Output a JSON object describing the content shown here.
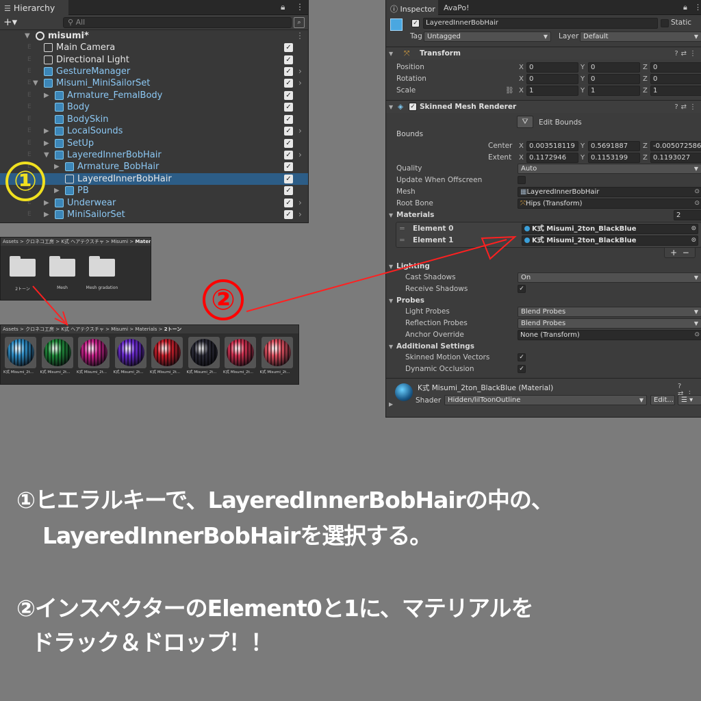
{
  "hierarchy": {
    "tab_label": "Hierarchy",
    "search_placeholder": "All",
    "rows": [
      {
        "label": "misumi*",
        "color": "white"
      },
      {
        "label": "Main Camera",
        "color": "white"
      },
      {
        "label": "Directional Light",
        "color": "white"
      },
      {
        "label": "GestureManager",
        "color": "blue"
      },
      {
        "label": "Misumi_MiniSailorSet",
        "color": "blue"
      },
      {
        "label": "Armature_FemalBody",
        "color": "blue"
      },
      {
        "label": "Body",
        "color": "blue"
      },
      {
        "label": "BodySkin",
        "color": "blue"
      },
      {
        "label": "LocalSounds",
        "color": "blue"
      },
      {
        "label": "SetUp",
        "color": "blue"
      },
      {
        "label": "LayeredInnerBobHair",
        "color": "blue"
      },
      {
        "label": "Armature_BobHair",
        "color": "blue"
      },
      {
        "label": "LayeredInnerBobHair",
        "color": "white"
      },
      {
        "label": "PB",
        "color": "blue"
      },
      {
        "label": "Underwear",
        "color": "blue"
      },
      {
        "label": "MiniSailorSet",
        "color": "blue"
      }
    ]
  },
  "project_folders": {
    "breadcrumb": [
      "Assets",
      "クロネコ工房",
      "K式 ヘアテクスチャ",
      "Misumi"
    ],
    "breadcrumb_last": "Materials",
    "folders": [
      "2トーン",
      "Mesh",
      "Mesh gradation"
    ]
  },
  "project_materials": {
    "breadcrumb": [
      "Assets",
      "クロネコ工房",
      "K式 ヘアテクスチャ",
      "Misumi",
      "Materials"
    ],
    "breadcrumb_last": "2トーン",
    "items": [
      {
        "label": "K式 Misumi_2t...",
        "color": "#2f8fc8"
      },
      {
        "label": "K式 Misumi_2t...",
        "color": "#1f8a3a"
      },
      {
        "label": "K式 Misumi_2t...",
        "color": "#c8208a"
      },
      {
        "label": "K式 Misumi_2t...",
        "color": "#6a2ad0"
      },
      {
        "label": "K式 Misumi_2t...",
        "color": "#c81e2a"
      },
      {
        "label": "K式 Misumi_2t...",
        "color": "#2a2a36"
      },
      {
        "label": "K式 Misumi_2t...",
        "color": "#d03050"
      },
      {
        "label": "K式 Misumi_2t...",
        "color": "#e05060"
      }
    ]
  },
  "inspector": {
    "tab1": "Inspector",
    "tab2": "AvaPo!",
    "object_name": "LayeredInnerBobHair",
    "static_label": "Static",
    "tag_label": "Tag",
    "tag_value": "Untagged",
    "layer_label": "Layer",
    "layer_value": "Default",
    "transform": {
      "title": "Transform",
      "position_label": "Position",
      "rotation_label": "Rotation",
      "scale_label": "Scale",
      "position": [
        "0",
        "0",
        "0"
      ],
      "rotation": [
        "0",
        "0",
        "0"
      ],
      "scale": [
        "1",
        "1",
        "1"
      ]
    },
    "smr": {
      "title": "Skinned Mesh Renderer",
      "edit_bounds": "Edit Bounds",
      "bounds_label": "Bounds",
      "center_label": "Center",
      "extent_label": "Extent",
      "center": [
        "0.003518119",
        "0.5691887",
        "-0.005072586"
      ],
      "extent": [
        "0.1172946",
        "0.1153199",
        "0.1193027"
      ],
      "quality_label": "Quality",
      "quality_value": "Auto",
      "update_offscreen_label": "Update When Offscreen",
      "mesh_label": "Mesh",
      "mesh_value": "LayeredInnerBobHair",
      "root_bone_label": "Root Bone",
      "root_bone_value": "Hips (Transform)",
      "materials_label": "Materials",
      "materials_count": "2",
      "elements": [
        {
          "label": "Element 0",
          "value": "K式 Misumi_2ton_BlackBlue"
        },
        {
          "label": "Element 1",
          "value": "K式 Misumi_2ton_BlackBlue"
        }
      ],
      "lighting_label": "Lighting",
      "cast_shadows_label": "Cast Shadows",
      "cast_shadows_value": "On",
      "receive_shadows_label": "Receive Shadows",
      "probes_label": "Probes",
      "light_probes_label": "Light Probes",
      "light_probes_value": "Blend Probes",
      "reflection_probes_label": "Reflection Probes",
      "reflection_probes_value": "Blend Probes",
      "anchor_override_label": "Anchor Override",
      "anchor_override_value": "None (Transform)",
      "additional_label": "Additional Settings",
      "skinned_motion_label": "Skinned Motion Vectors",
      "dynamic_occlusion_label": "Dynamic Occlusion"
    },
    "material": {
      "title": "K式 Misumi_2ton_BlackBlue (Material)",
      "shader_label": "Shader",
      "shader_value": "Hidden/lilToonOutline",
      "edit_label": "Edit..."
    }
  },
  "annotations": {
    "num1": "①",
    "num2": "②",
    "line1a": "①ヒエラルキーで、LayeredInnerBobHairの中の、",
    "line1b": "LayeredInnerBobHairを選択する。",
    "line2a": "②インスペクターのElement0と1に、マテリアルを",
    "line2b": "ドラック＆ドロップ！！"
  },
  "colors": {
    "selection": "#2c5d87",
    "arrow_red": "#ff2020",
    "num1": "#f0e020"
  }
}
